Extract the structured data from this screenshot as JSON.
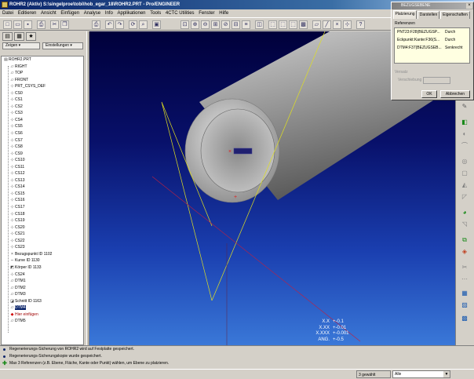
{
  "window": {
    "title": "ROHR2 (Aktiv) S:\\singelproe\\tobi\\hob_egar_18\\ROHR2.PRT - Pro/ENGINEER"
  },
  "menu": [
    "Datei",
    "Editieren",
    "Ansicht",
    "Einfügen",
    "Analyse",
    "Info",
    "Applikationen",
    "Tools",
    "4CTC Utilities",
    "Fenster",
    "Hilfe"
  ],
  "left_panel": {
    "show_label": "Zeigen ▾",
    "settings_label": "Einstellungen ▾",
    "tree": [
      {
        "icon": "part-icon",
        "glyph": "▤",
        "label": "ROHR2.PRT",
        "level": 0
      },
      {
        "icon": "datum-plane-icon",
        "glyph": "▱",
        "label": "RIGHT",
        "level": 1
      },
      {
        "icon": "datum-plane-icon",
        "glyph": "▱",
        "label": "TOP",
        "level": 1
      },
      {
        "icon": "datum-plane-icon",
        "glyph": "▱",
        "label": "FRONT",
        "level": 1
      },
      {
        "icon": "coordinate-system-icon",
        "glyph": "⊹",
        "label": "PRT_CSYS_DEF",
        "level": 1
      },
      {
        "icon": "coordinate-system-icon",
        "glyph": "⊹",
        "label": "CS0",
        "level": 1
      },
      {
        "icon": "coordinate-system-icon",
        "glyph": "⊹",
        "label": "CS1",
        "level": 1
      },
      {
        "icon": "coordinate-system-icon",
        "glyph": "⊹",
        "label": "CS2",
        "level": 1
      },
      {
        "icon": "coordinate-system-icon",
        "glyph": "⊹",
        "label": "CS3",
        "level": 1
      },
      {
        "icon": "coordinate-system-icon",
        "glyph": "⊹",
        "label": "CS4",
        "level": 1
      },
      {
        "icon": "coordinate-system-icon",
        "glyph": "⊹",
        "label": "CS5",
        "level": 1
      },
      {
        "icon": "coordinate-system-icon",
        "glyph": "⊹",
        "label": "CS6",
        "level": 1
      },
      {
        "icon": "coordinate-system-icon",
        "glyph": "⊹",
        "label": "CS7",
        "level": 1
      },
      {
        "icon": "coordinate-system-icon",
        "glyph": "⊹",
        "label": "CS8",
        "level": 1
      },
      {
        "icon": "coordinate-system-icon",
        "glyph": "⊹",
        "label": "CS9",
        "level": 1
      },
      {
        "icon": "coordinate-system-icon",
        "glyph": "⊹",
        "label": "CS10",
        "level": 1
      },
      {
        "icon": "coordinate-system-icon",
        "glyph": "⊹",
        "label": "CS11",
        "level": 1
      },
      {
        "icon": "coordinate-system-icon",
        "glyph": "⊹",
        "label": "CS12",
        "level": 1
      },
      {
        "icon": "coordinate-system-icon",
        "glyph": "⊹",
        "label": "CS13",
        "level": 1
      },
      {
        "icon": "coordinate-system-icon",
        "glyph": "⊹",
        "label": "CS14",
        "level": 1
      },
      {
        "icon": "coordinate-system-icon",
        "glyph": "⊹",
        "label": "CS15",
        "level": 1
      },
      {
        "icon": "coordinate-system-icon",
        "glyph": "⊹",
        "label": "CS16",
        "level": 1
      },
      {
        "icon": "coordinate-system-icon",
        "glyph": "⊹",
        "label": "CS17",
        "level": 1
      },
      {
        "icon": "coordinate-system-icon",
        "glyph": "⊹",
        "label": "CS18",
        "level": 1
      },
      {
        "icon": "coordinate-system-icon",
        "glyph": "⊹",
        "label": "CS19",
        "level": 1
      },
      {
        "icon": "coordinate-system-icon",
        "glyph": "⊹",
        "label": "CS20",
        "level": 1
      },
      {
        "icon": "coordinate-system-icon",
        "glyph": "⊹",
        "label": "CS21",
        "level": 1
      },
      {
        "icon": "coordinate-system-icon",
        "glyph": "⊹",
        "label": "CS22",
        "level": 1
      },
      {
        "icon": "coordinate-system-icon",
        "glyph": "⊹",
        "label": "CS23",
        "level": 1
      },
      {
        "icon": "datum-point-icon",
        "glyph": "×",
        "label": "Bezugspunkt ID 1102",
        "level": 1
      },
      {
        "icon": "curve-icon",
        "glyph": "∼",
        "label": "Kurve ID 1130",
        "level": 1
      },
      {
        "icon": "solid-body-icon",
        "glyph": "◩",
        "label": "Körper ID 1133",
        "level": 1
      },
      {
        "icon": "coordinate-system-icon",
        "glyph": "⊹",
        "label": "CS24",
        "level": 1
      },
      {
        "icon": "datum-plane-icon",
        "glyph": "▱",
        "label": "DTM1",
        "level": 1
      },
      {
        "icon": "datum-plane-icon",
        "glyph": "▱",
        "label": "DTM2",
        "level": 1
      },
      {
        "icon": "datum-plane-icon",
        "glyph": "▱",
        "label": "DTM3",
        "level": 1
      },
      {
        "icon": "cut-feature-icon",
        "glyph": "◪",
        "label": "Schnitt ID 1163",
        "level": 1
      },
      {
        "icon": "datum-plane-icon",
        "glyph": "▱",
        "label": "DTM4",
        "level": 1,
        "selected": true
      },
      {
        "icon": "insert-here-icon",
        "glyph": "◆",
        "label": "Hier einfügen",
        "level": 1,
        "insert": true
      },
      {
        "icon": "datum-plane-icon",
        "glyph": "▱",
        "label": "DTM5",
        "level": 1
      }
    ]
  },
  "viewport": {
    "tolerances": [
      {
        "key": "X.X",
        "value": "+-0.1"
      },
      {
        "key": "X.XX",
        "value": "+-0.01"
      },
      {
        "key": "X.XXX",
        "value": "+-0.001"
      },
      {
        "key": "ANG.",
        "value": "+-0.5"
      }
    ]
  },
  "dialog": {
    "title": "BEZUGSEBENE",
    "tabs": [
      "Platzierung",
      "Darstellen",
      "Eigenschaften"
    ],
    "refs_label": "Referenzen",
    "refs": [
      {
        "ref": "PNT23:F28(BEZUGSP...",
        "constraint": "Durch"
      },
      {
        "ref": "Eckpunkt:Kante:F36(S...",
        "constraint": "Durch"
      },
      {
        "ref": "DTM4:F37(BEZUGSEB...",
        "constraint": "Senkrecht"
      }
    ],
    "offset_label": "Versatz",
    "shift_label": "Verschiebung",
    "ok_label": "OK",
    "cancel_label": "Abbrechen"
  },
  "status": [
    "Regenerierungs-Sicherung von ROHR2 wird auf Festplatte gespeichert.",
    "Regenerierungs-Sicherungskopie wurde gespeichert.",
    "Max 3 Referenzen (z.B. Ebene, Fläche, Kante oder Punkt) wählen, um Ebene zu platzieren."
  ],
  "bottom": {
    "selected": "3 gewählt",
    "filter": "Alle"
  },
  "colors": {
    "title_active": "#0a246a",
    "viewport_top": "#00003a",
    "viewport_bottom": "#3a78d8",
    "tube": "#c0c0c0"
  }
}
